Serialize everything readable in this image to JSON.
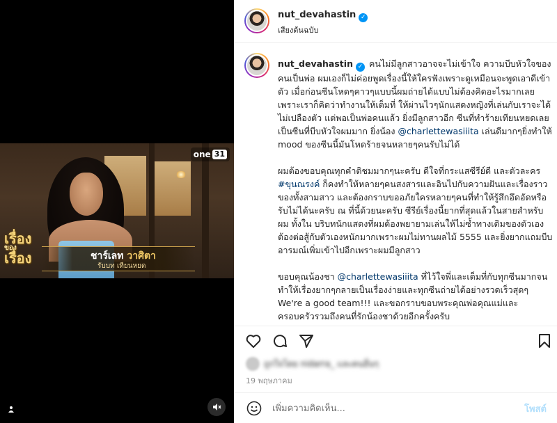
{
  "media": {
    "channel_badge": {
      "text": "one",
      "number": "31"
    },
    "show_logo": {
      "line1": "เรื่อง",
      "line2": "ของ",
      "line3": "เรื่อง"
    },
    "lower_third": {
      "name_first": "ชาร์เลท",
      "name_last": "วาศิตา",
      "role": "รับบท เทียนหยด"
    }
  },
  "header": {
    "username": "nut_devahastin",
    "audio": "เสียงต้นฉบับ"
  },
  "caption": {
    "username": "nut_devahastin",
    "p1_a": "คนไม่มีลูกสาวอาจจะไม่เข้าใจ ความบีบหัวใจของคนเป็นพ่อ ผมเองก็ไม่ค่อยพูดเรื่องนี้ให้ใครฟังเพราะดูเหมือนจะพูดเอาดีเข้าตัว เมื่อก่อนซีนโหดๆคาวๆแบบนี้ผมถ่ายได้แบบไม่ต้องคิดอะไรมากเลย เพราะเราก็คิดว่าทำงานให้เต็มที่ ให้ผ่านไวๆนักแสดงหญิงที่เล่นกับเราจะได้ไม่เปลืองตัว แต่พอเป็นพ่อคนแล้ว ยิ่งมีลูกสาวอีก ซีนที่ทำร้ายเทียนหยดเลยเป็นซีนที่บีบหัวใจผมมาก ยิ่งน้อง ",
    "p1_mention": "@charlettewasiiita",
    "p1_b": " เล่นดีมากๆยิ่งทำให้ mood ของซีนนี้มันโหดร้ายจนหลายๆคนรับไม่ได้",
    "p2_a": "ผมต้องขอบคุณทุกคำติชมมากๆนะครับ ดีใจที่กระแสซีรีย์ดี และตัวละคร ",
    "p2_hashtag": "#ขุนณรงค์",
    "p2_b": " ก็คงทำให้หลายๆคนสงสารและอินไปกับความฝันและเรื่องราวของทั้งสามสาว และต้องกราบขออภัยใครหลายๆคนที่ทำให้รู้สึกอึดอัดหรือรับไม่ได้นะครับ ณ ที่นี้ด้วยนะครับ ซีรีย์เรื่องนี้ยากที่สุดแล้วในสายสำหรับผม ทั้งใน บริบทนักแสดงที่ผมต้องพยายามเล่นให้ไม่ซ้ำทางเดิมของตัวเอง ต้องต่อสู้กับตัวเองหนักมากเพราะผมไม่ทานผลไม้ 5555 และยิ่งยากแถมบีบอารมณ์เพิ่มเข้าไปอีกเพราะผมมีลูกสาว",
    "p3_a": "ขอบคุณน้องชา ",
    "p3_mention": "@charlettewasiiita",
    "p3_b": " ที่ไว้ใจพี่และเต็มที่กับทุกซีนมากจนทำให้เรื่องยากๆกลายเป็นเรื่องง่ายและทุกซีนถ่ายได้อย่างรวดเร็วสุดๆ We're a good team!!! และขอกราบขอบพระคุณพ่อคุณแม่และครอบครัวรวมถึงคนที่รักน้องชาด้วยอีกครั้งครับ",
    "p3_emoji": "□□□□□□□□□□□"
  },
  "likes": {
    "text": "ถูกใจโดย nidarra_ และคนอื่นๆ"
  },
  "date": "19 พฤษภาคม",
  "comment": {
    "placeholder": "เพิ่มความคิดเห็น...",
    "post_label": "โพสต์"
  },
  "colors": {
    "accent": "#0095f6",
    "mention": "#00376b",
    "post_disabled": "#b2dffc"
  },
  "icons": [
    "heart-icon",
    "comment-icon",
    "share-icon",
    "bookmark-icon",
    "emoji-icon",
    "mute-icon",
    "user-tag-icon",
    "verified-icon"
  ]
}
